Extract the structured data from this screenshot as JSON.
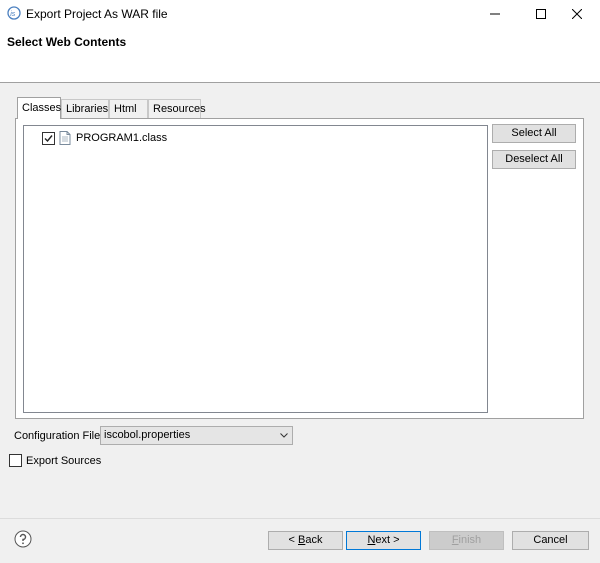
{
  "window": {
    "title": "Export Project As WAR file",
    "app_icon": "iscobol-icon",
    "controls": [
      "minimize-icon",
      "maximize-icon",
      "close-icon"
    ]
  },
  "banner": {
    "title": "Select Web Contents"
  },
  "tabs": [
    {
      "label": "Classes",
      "active": true
    },
    {
      "label": "Libraries",
      "active": false
    },
    {
      "label": "Html",
      "active": false
    },
    {
      "label": "Resources",
      "active": false
    }
  ],
  "class_list": {
    "items": [
      {
        "label": "PROGRAM1.class",
        "checked": true,
        "icon": "file-icon"
      }
    ]
  },
  "side_buttons": {
    "select_all": "Select All",
    "deselect_all": "Deselect All"
  },
  "config": {
    "label": "Configuration File:",
    "value": "iscobol.properties"
  },
  "export_sources": {
    "label": "Export Sources",
    "checked": false
  },
  "footer": {
    "back_prefix": "< ",
    "back_key": "B",
    "back_rest": "ack",
    "next_key": "N",
    "next_rest": "ext >",
    "finish_key": "F",
    "finish_rest": "inish",
    "cancel": "Cancel",
    "finish_enabled": false,
    "help_icon": "help-icon"
  },
  "colors": {
    "focus_border": "#0078d7",
    "disabled_text": "#a0a0a0"
  }
}
